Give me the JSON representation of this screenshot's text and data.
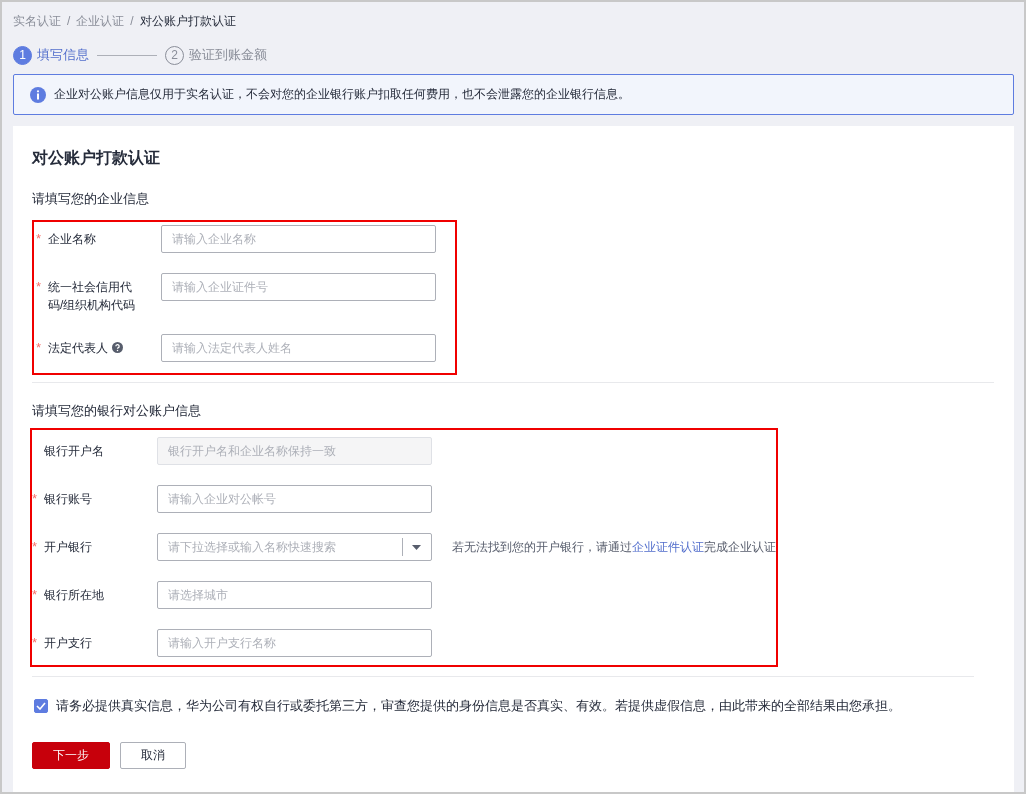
{
  "breadcrumb": [
    {
      "text": "实名认证"
    },
    {
      "separator": "/",
      "text": "企业认证"
    },
    {
      "separator": "/",
      "text": "对公账户打款认证"
    }
  ],
  "steps": [
    {
      "number": "1",
      "label": "填写信息",
      "selected": true
    },
    {
      "number": "2",
      "label": "验证到账金额",
      "selected": false
    }
  ],
  "notice": "企业对公账户信息仅用于实名认证，不会对您的企业银行账户扣取任何费用，也不会泄露您的企业银行信息。",
  "card": {
    "title": "对公账户打款认证",
    "sections": [
      {
        "heading": "请填写您的企业信息",
        "highlighted": true,
        "fields": [
          {
            "kind": "text",
            "required_mark": "*",
            "label": "企业名称",
            "placeholder": "请输入企业名称"
          },
          {
            "kind": "text",
            "required_mark": "*",
            "label": "统一社会信用代码/组织机构代码",
            "placeholder": "请输入企业证件号"
          },
          {
            "kind": "text",
            "required_mark": "*",
            "label": "法定代表人",
            "help": true,
            "placeholder": "请输入法定代表人姓名"
          }
        ]
      },
      {
        "heading": "请填写您的银行对公账户信息",
        "highlighted": true,
        "fields": [
          {
            "kind": "text",
            "label": "银行开户名",
            "disabled": true,
            "placeholder": "银行开户名和企业名称保持一致"
          },
          {
            "kind": "text",
            "required_mark": "*",
            "label": "银行账号",
            "placeholder": "请输入企业对公帐号"
          },
          {
            "kind": "select",
            "required_mark": "*",
            "label": "开户银行",
            "placeholder": "请下拉选择或输入名称快速搜索",
            "note": {
              "before": "若无法找到您的开户银行，请通过",
              "link": "企业证件认证",
              "after": "完成企业认证"
            }
          },
          {
            "kind": "text",
            "required_mark": "*",
            "label": "银行所在地",
            "placeholder": "请选择城市"
          },
          {
            "kind": "text",
            "required_mark": "*",
            "label": "开户支行",
            "placeholder": "请输入开户支行名称"
          }
        ]
      }
    ]
  },
  "agreement": {
    "checked": true,
    "text": "请务必提供真实信息，华为公司有权自行或委托第三方，审查您提供的身份信息是否真实、有效。若提供虚假信息，由此带来的全部结果由您承担。"
  },
  "buttons": [
    {
      "label": "下一步",
      "kind": "primary"
    },
    {
      "label": "取消",
      "kind": "default"
    }
  ]
}
